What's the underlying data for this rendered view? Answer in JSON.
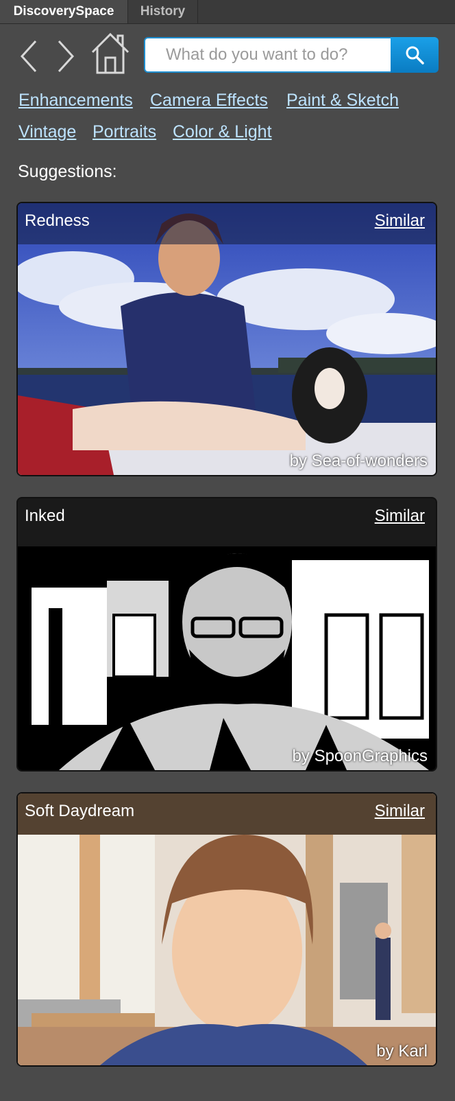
{
  "tabs": [
    {
      "label": "DiscoverySpace"
    },
    {
      "label": "History"
    }
  ],
  "search": {
    "placeholder": "What do you want to do?"
  },
  "categories": [
    {
      "label": "Enhancements"
    },
    {
      "label": "Camera Effects"
    },
    {
      "label": "Paint & Sketch"
    },
    {
      "label": "Vintage"
    },
    {
      "label": "Portraits"
    },
    {
      "label": "Color & Light"
    }
  ],
  "suggestions_heading": "Suggestions:",
  "cards": [
    {
      "title": "Redness",
      "similar": "Similar",
      "credit": "by Sea-of-wonders"
    },
    {
      "title": "Inked",
      "similar": "Similar",
      "credit": "by SpoonGraphics"
    },
    {
      "title": "Soft Daydream",
      "similar": "Similar",
      "credit": "by Karl"
    }
  ],
  "colors": {
    "background": "#4a4a4a",
    "link": "#bde3ff",
    "search_accent": "#1e8fd1"
  },
  "icons": {
    "back": "chevron-left-icon",
    "forward": "chevron-right-icon",
    "home": "home-icon",
    "search": "magnifier-icon"
  }
}
